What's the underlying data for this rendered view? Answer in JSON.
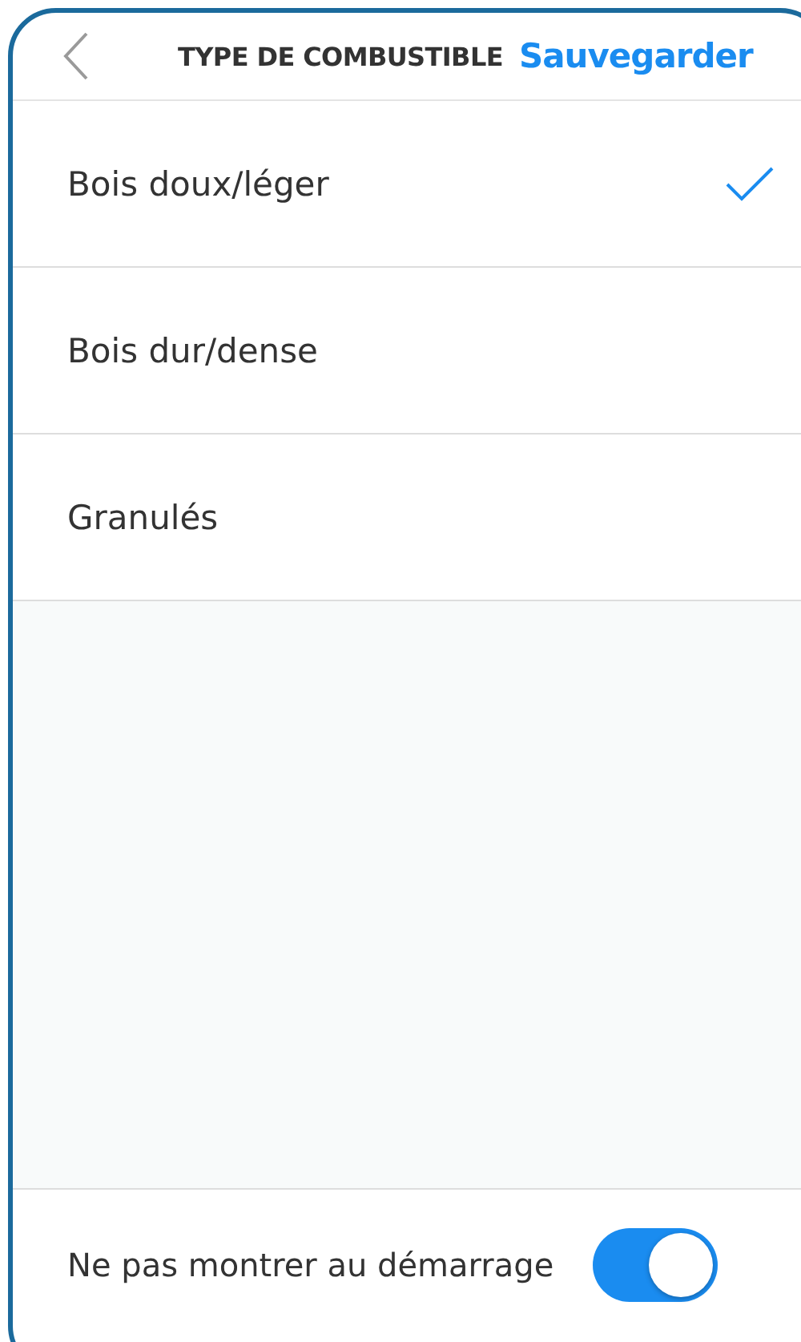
{
  "header": {
    "title": "TYPE DE COMBUSTIBLE",
    "action": "Sauvegarder"
  },
  "options": [
    {
      "label": "Bois doux/léger",
      "selected": true
    },
    {
      "label": "Bois dur/dense",
      "selected": false
    },
    {
      "label": "Granulés",
      "selected": false
    }
  ],
  "footer": {
    "label": "Ne pas montrer au démarrage",
    "on": true
  }
}
